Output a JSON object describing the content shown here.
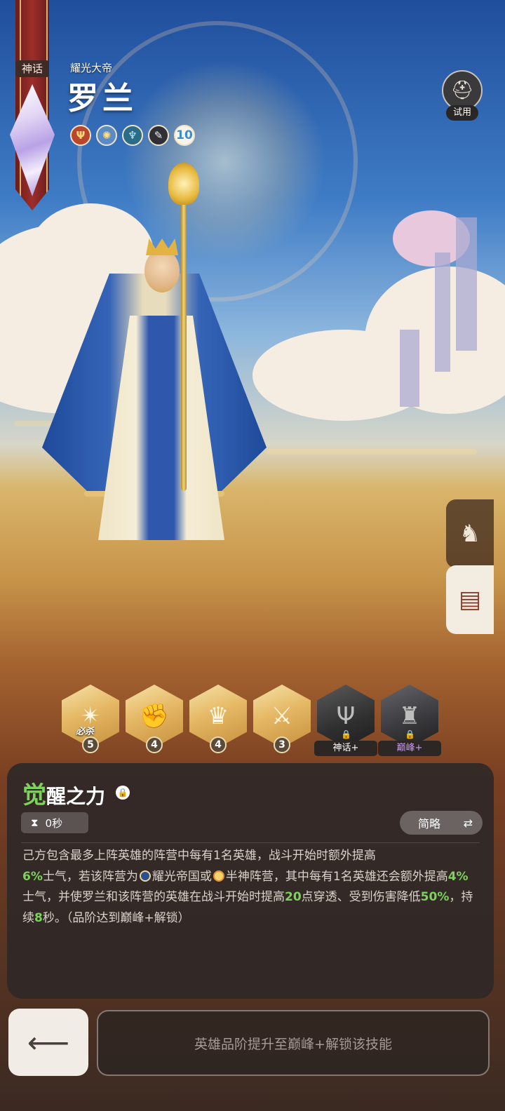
{
  "hero": {
    "rarity": "神话",
    "epithet": "耀光大帝",
    "name": "罗兰",
    "badges": [
      {
        "icon": "trident-faction-icon",
        "color": "#b8472c"
      },
      {
        "icon": "sun-faction-icon",
        "color": "#5a8bc6"
      },
      {
        "icon": "class-icon",
        "color": "#2b6c86"
      },
      {
        "icon": "weapon-type-icon",
        "color": "#2f2f35"
      },
      {
        "text": "10"
      }
    ]
  },
  "trial": {
    "label": "试用"
  },
  "skills": [
    {
      "level": "5",
      "tag": "必杀",
      "icon": "starburst-icon"
    },
    {
      "level": "4",
      "icon": "fist-icon"
    },
    {
      "level": "4",
      "icon": "crown-hand-icon"
    },
    {
      "level": "3",
      "icon": "sword-sparkle-icon"
    },
    {
      "lock_label": "神话+",
      "icon": "trident-dark-icon"
    },
    {
      "lock_label": "巅峰+",
      "icon": "knight-dark-icon",
      "selected": true
    }
  ],
  "detail": {
    "title_first": "觉",
    "title_rest": "醒之力",
    "cooldown": "0秒",
    "view_mode": "简略",
    "description": {
      "p1": "己方包含最多上阵英雄的阵营中每有1名英雄，战斗开始时额外提高",
      "v1": "6%",
      "p2": "士气，若该阵营为",
      "faction1": "耀光帝国",
      "p3": "或",
      "faction2": "半神阵营",
      "p4": "，其中每有1名英雄还会额外提高",
      "v2": "4%",
      "p5": "士气，并使罗兰和该阵营的英雄在战斗开始时提高",
      "v3": "20",
      "p6": "点穿透、受到伤害降低",
      "v4": "50%",
      "p7": "，持续",
      "v5": "8",
      "p8": "秒。（品阶达到巅峰+解锁）"
    }
  },
  "bottom": {
    "unlock_label": "英雄品阶提升至巅峰+解锁该技能"
  },
  "colors": {
    "highlight": "#7bd35b",
    "panel": "#302826",
    "ribbon": "#9c2e2a"
  }
}
